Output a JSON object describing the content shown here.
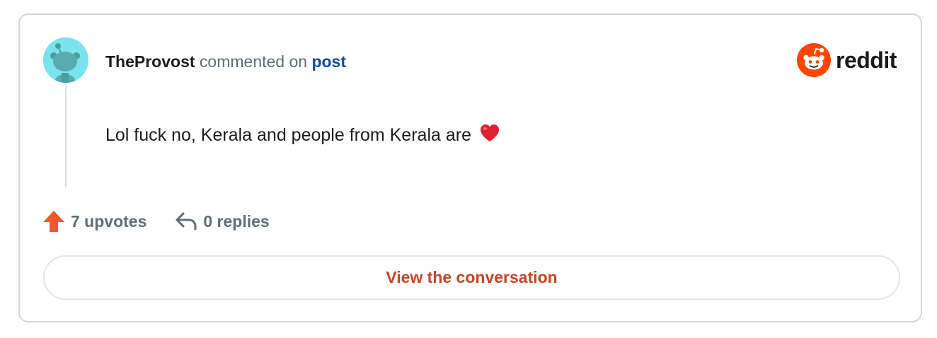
{
  "comment": {
    "author": "TheProvost",
    "action_text": "commented on",
    "target_link": "post",
    "body": "Lol fuck no, Kerala and people from Kerala are",
    "body_emoji": "heart-emoji",
    "upvotes_label": "7 upvotes",
    "replies_label": "0 replies"
  },
  "brand": {
    "name": "reddit",
    "color": "#ff4500"
  },
  "cta": {
    "label": "View the conversation",
    "color": "#c94420"
  },
  "colors": {
    "avatar_bg": "#7be3ee",
    "link": "#0f4aa6",
    "muted": "#5f6e79",
    "upvote": "#f2582b"
  },
  "icons": {
    "avatar": "snoo-avatar-icon",
    "logo": "reddit-snoo-icon",
    "upvote": "upvote-arrow-icon",
    "reply": "reply-arrow-icon"
  }
}
